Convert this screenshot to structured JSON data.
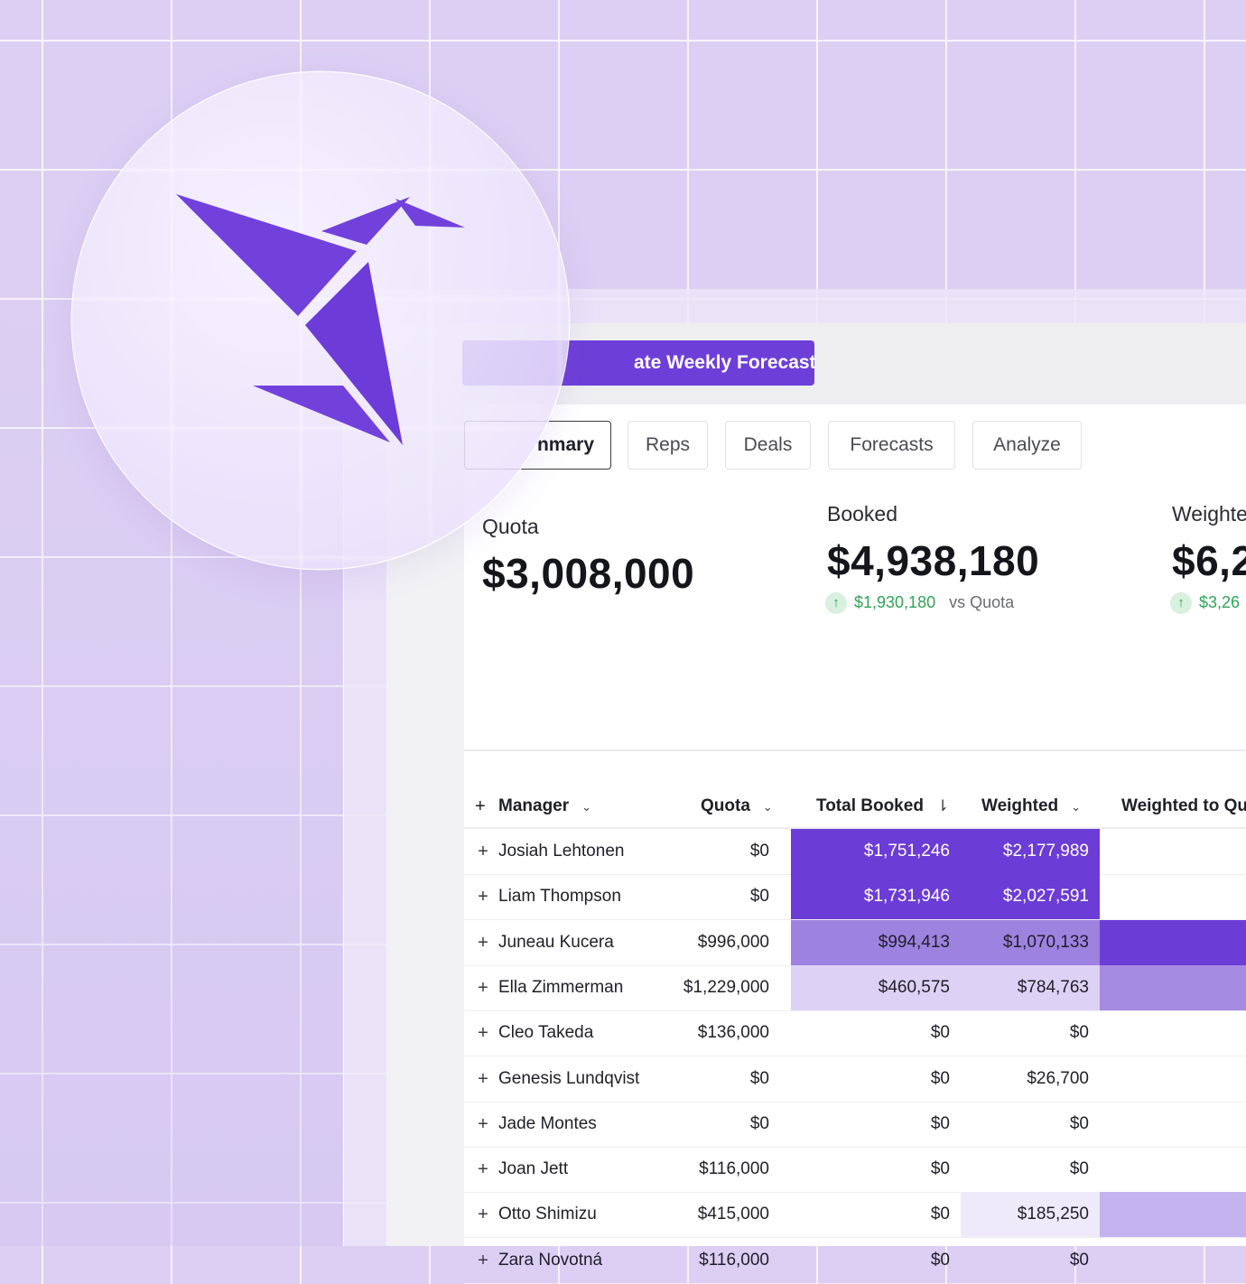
{
  "colors": {
    "accent": "#6e3fd8",
    "background": "#dccff3",
    "positive": "#2fa455"
  },
  "logo": {
    "icon": "origami-bird-logo-icon"
  },
  "toolbar": {
    "forecast_button": "ate Weekly Forecast"
  },
  "tabs": [
    {
      "label": "nmary",
      "active": true
    },
    {
      "label": "Reps",
      "active": false
    },
    {
      "label": "Deals",
      "active": false
    },
    {
      "label": "Forecasts",
      "active": false
    },
    {
      "label": "Analyze",
      "active": false
    }
  ],
  "metrics": {
    "quota": {
      "label": "Quota",
      "value": "$3,008,000"
    },
    "booked": {
      "label": "Booked",
      "value": "$4,938,180",
      "delta": "$1,930,180",
      "vs": "vs Quota"
    },
    "weighted": {
      "label": "Weighte",
      "value": "$6,2",
      "delta": "$3,26"
    }
  },
  "table": {
    "headers": {
      "manager": "Manager",
      "quota": "Quota",
      "total_booked": "Total Booked",
      "weighted": "Weighted",
      "weighted_to_quota": "Weighted to Qu"
    },
    "rows": [
      {
        "name": "Josiah Lehtonen",
        "quota": "$0",
        "booked": "$1,751,246",
        "weighted": "$2,177,989",
        "booked_level": "dark",
        "weighted_level": "dark",
        "wq_level": ""
      },
      {
        "name": "Liam Thompson",
        "quota": "$0",
        "booked": "$1,731,946",
        "weighted": "$2,027,591",
        "booked_level": "dark",
        "weighted_level": "dark",
        "wq_level": ""
      },
      {
        "name": "Juneau Kucera",
        "quota": "$996,000",
        "booked": "$994,413",
        "weighted": "$1,070,133",
        "booked_level": "mid",
        "weighted_level": "mid",
        "wq_level": "wq-dark"
      },
      {
        "name": "Ella Zimmerman",
        "quota": "$1,229,000",
        "booked": "$460,575",
        "weighted": "$784,763",
        "booked_level": "light",
        "weighted_level": "light",
        "wq_level": "wq-mid"
      },
      {
        "name": "Cleo Takeda",
        "quota": "$136,000",
        "booked": "$0",
        "weighted": "$0",
        "booked_level": "",
        "weighted_level": "",
        "wq_level": ""
      },
      {
        "name": "Genesis Lundqvist",
        "quota": "$0",
        "booked": "$0",
        "weighted": "$26,700",
        "booked_level": "",
        "weighted_level": "",
        "wq_level": ""
      },
      {
        "name": "Jade Montes",
        "quota": "$0",
        "booked": "$0",
        "weighted": "$0",
        "booked_level": "",
        "weighted_level": "",
        "wq_level": ""
      },
      {
        "name": "Joan Jett",
        "quota": "$116,000",
        "booked": "$0",
        "weighted": "$0",
        "booked_level": "",
        "weighted_level": "",
        "wq_level": ""
      },
      {
        "name": "Otto Shimizu",
        "quota": "$415,000",
        "booked": "$0",
        "weighted": "$185,250",
        "booked_level": "",
        "weighted_level": "faint",
        "wq_level": "wq-light"
      },
      {
        "name": "Zara Novotná",
        "quota": "$116,000",
        "booked": "$0",
        "weighted": "$0",
        "booked_level": "",
        "weighted_level": "",
        "wq_level": ""
      }
    ]
  }
}
